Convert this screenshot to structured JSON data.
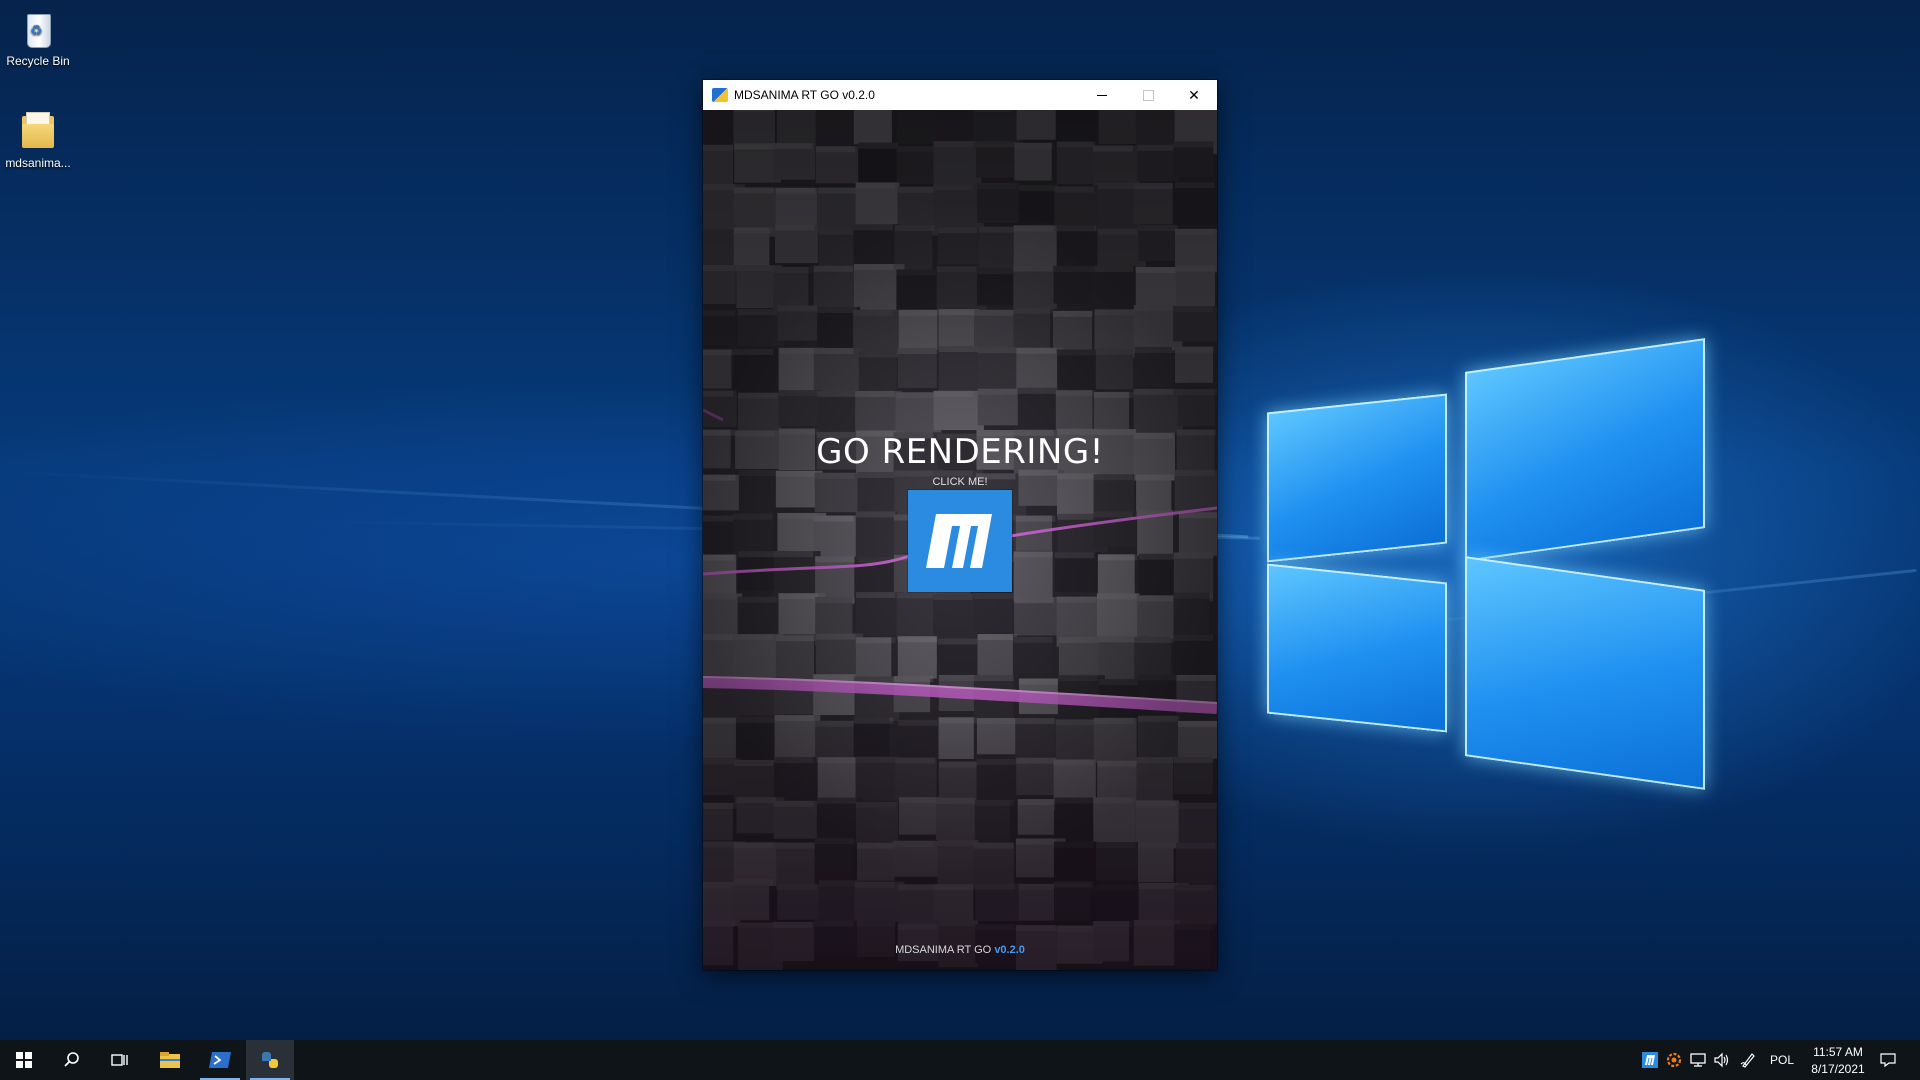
{
  "desktop": {
    "icons": [
      {
        "label": "Recycle Bin",
        "icon": "recycle-bin-icon"
      },
      {
        "label": "mdsanima...",
        "icon": "folder-icon"
      }
    ]
  },
  "window": {
    "title": "MDSANIMA RT GO v0.2.0",
    "buttons": {
      "minimize": "minimize-icon",
      "maximize": "maximize-icon",
      "close": "close-icon"
    },
    "close_glyph": "✕"
  },
  "app": {
    "headline": "GO RENDERING!",
    "subtext": "CLICK ME!",
    "logo_icon": "mdsanima-logo-icon",
    "footer_name": "MDSANIMA RT GO ",
    "footer_version": "v0.2.0",
    "accent": "#2b8be0",
    "stripe_color": "#e070e8"
  },
  "taskbar": {
    "items": [
      "start-icon",
      "search-icon",
      "task-view-icon",
      "file-explorer-icon",
      "powershell-icon",
      "python-icon"
    ],
    "active": "python-icon",
    "tray": [
      "mdsanima-tray-icon",
      "settings-tray-icon",
      "network-icon",
      "volume-icon",
      "pen-icon"
    ],
    "language": "POL",
    "time": "11:57 AM",
    "date": "8/17/2021",
    "notifications": "notification-icon"
  }
}
